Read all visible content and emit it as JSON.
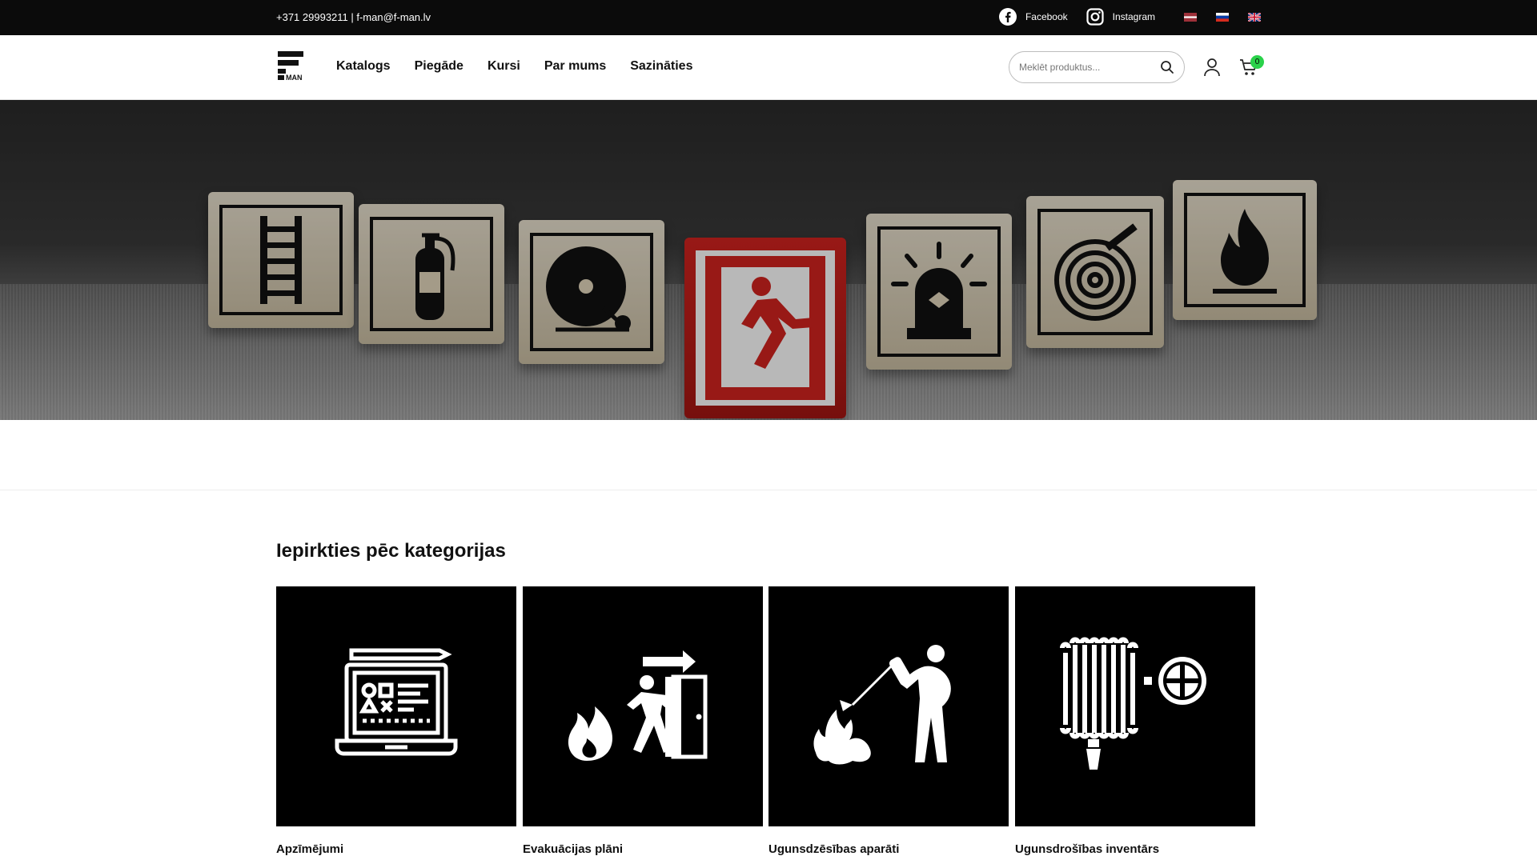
{
  "topbar": {
    "contact": "+371 29993211 | f-man@f-man.lv",
    "facebook_label": "Facebook",
    "instagram_label": "Instagram",
    "languages": [
      "lv-flag",
      "ru-flag",
      "en-flag"
    ]
  },
  "header": {
    "logo_text": "MAN",
    "nav": [
      "Katalogs",
      "Piegāde",
      "Kursi",
      "Par mums",
      "Sazināties"
    ],
    "search_placeholder": "Meklēt produktus...",
    "cart_count": "0",
    "icons": [
      "search-icon",
      "user-icon",
      "cart-icon"
    ]
  },
  "hero": {
    "blocks": [
      "ladder-icon",
      "extinguisher-icon",
      "bell-icon",
      "exit-icon",
      "siren-icon",
      "hose-icon",
      "flame-icon"
    ]
  },
  "categories": {
    "title": "Iepirkties pēc kategorijas",
    "items": [
      {
        "label": "Apzīmējumi",
        "icon": "laptop-signs-icon"
      },
      {
        "label": "Evakuācijas plāni",
        "icon": "evacuation-icon"
      },
      {
        "label": "Ugunsdzēsības aparāti",
        "icon": "extinguishing-person-icon"
      },
      {
        "label": "Ugunsdrošības inventārs",
        "icon": "fire-hose-reel-icon"
      }
    ]
  },
  "colors": {
    "topbar_bg": "#0b0b0b",
    "badge": "#2ad24a",
    "tile_bg": "#000000",
    "exit_red": "#d3231f"
  }
}
